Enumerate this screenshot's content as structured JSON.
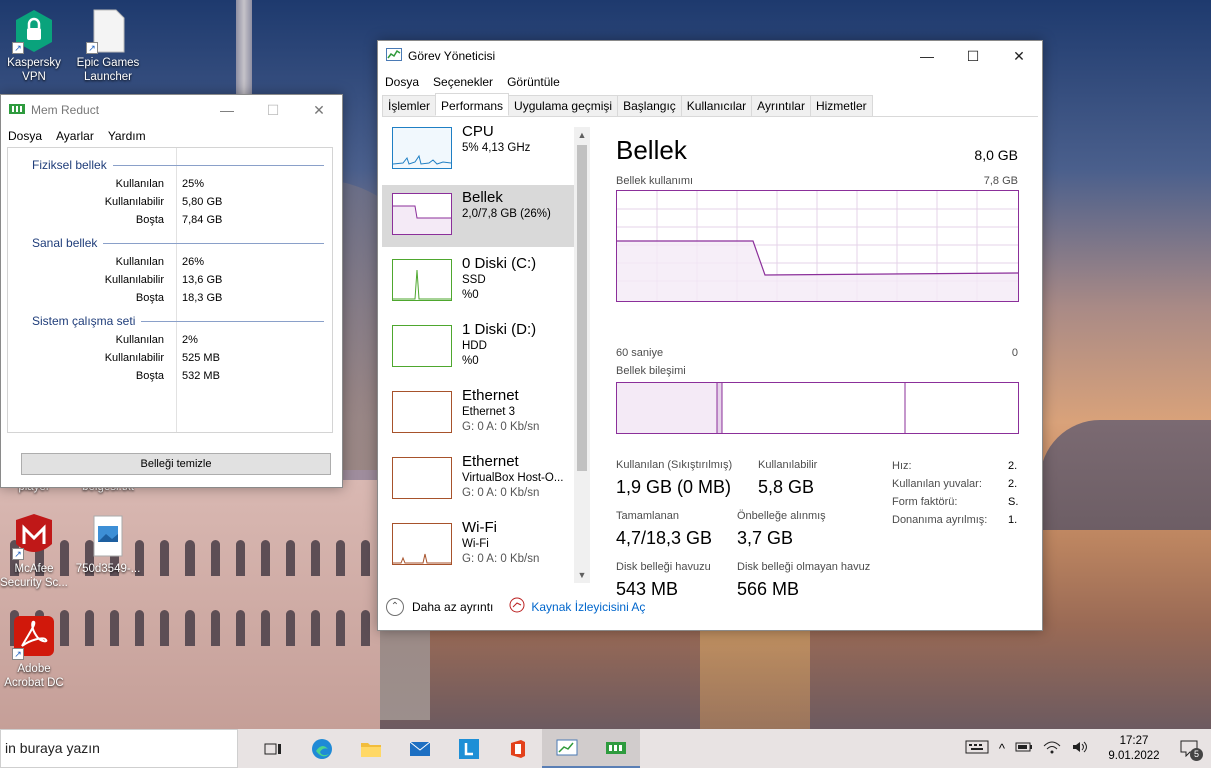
{
  "desktop": {
    "icons": [
      {
        "label": "Kaspersky VPN",
        "icon": "kaspersky-vpn-icon"
      },
      {
        "label": "Epic Games Launcher",
        "icon": "epic-games-icon"
      },
      {
        "label": "player",
        "icon": "player-icon"
      },
      {
        "label": "belgesi.txt",
        "icon": "text-file-icon"
      },
      {
        "label": "McAfee Security Sc...",
        "icon": "mcafee-icon"
      },
      {
        "label": "750d3549-...",
        "icon": "image-file-icon"
      },
      {
        "label": "Adobe Acrobat DC",
        "icon": "adobe-acrobat-icon"
      }
    ]
  },
  "memreduct": {
    "title": "Mem Reduct",
    "menu": [
      "Dosya",
      "Ayarlar",
      "Yardım"
    ],
    "sections": [
      {
        "header": "Fiziksel bellek",
        "rows": [
          {
            "k": "Kullanılan",
            "v": "25%"
          },
          {
            "k": "Kullanılabilir",
            "v": "5,80 GB"
          },
          {
            "k": "Boşta",
            "v": "7,84 GB"
          }
        ]
      },
      {
        "header": "Sanal bellek",
        "rows": [
          {
            "k": "Kullanılan",
            "v": "26%"
          },
          {
            "k": "Kullanılabilir",
            "v": "13,6 GB"
          },
          {
            "k": "Boşta",
            "v": "18,3 GB"
          }
        ]
      },
      {
        "header": "Sistem çalışma seti",
        "rows": [
          {
            "k": "Kullanılan",
            "v": "2%"
          },
          {
            "k": "Kullanılabilir",
            "v": "525 MB"
          },
          {
            "k": "Boşta",
            "v": "532 MB"
          }
        ]
      }
    ],
    "clean_button": "Belleği temizle"
  },
  "taskmgr": {
    "title": "Görev Yöneticisi",
    "menu": [
      "Dosya",
      "Seçenekler",
      "Görüntüle"
    ],
    "tabs": [
      "İşlemler",
      "Performans",
      "Uygulama geçmişi",
      "Başlangıç",
      "Kullanıcılar",
      "Ayrıntılar",
      "Hizmetler"
    ],
    "active_tab": "Performans",
    "sidebar": [
      {
        "name": "CPU",
        "l1": "5% 4,13 GHz",
        "l2": "",
        "color": "#1f7fc4"
      },
      {
        "name": "Bellek",
        "l1": "2,0/7,8 GB (26%)",
        "l2": "",
        "color": "#8b2f9a"
      },
      {
        "name": "0 Diski (C:)",
        "l1": "SSD",
        "l2": "%0",
        "color": "#4ea72e"
      },
      {
        "name": "1 Diski (D:)",
        "l1": "HDD",
        "l2": "%0",
        "color": "#4ea72e"
      },
      {
        "name": "Ethernet",
        "l1": "Ethernet 3",
        "l2": "G: 0 A: 0 Kb/sn",
        "color": "#a7522b"
      },
      {
        "name": "Ethernet",
        "l1": "VirtualBox Host-O...",
        "l2": "G: 0 A: 0 Kb/sn",
        "color": "#a7522b"
      },
      {
        "name": "Wi-Fi",
        "l1": "Wi-Fi",
        "l2": "G: 0 A: 0 Kb/sn",
        "color": "#a7522b"
      }
    ],
    "memory": {
      "title": "Bellek",
      "total": "8,0 GB",
      "usage_label": "Bellek kullanımı",
      "usage_max": "7,8 GB",
      "time_left": "60 saniye",
      "time_right": "0",
      "composition_label": "Bellek bileşimi",
      "stats": [
        {
          "k": "Kullanılan (Sıkıştırılmış)",
          "v": "1,9 GB (0 MB)"
        },
        {
          "k": "Kullanılabilir",
          "v": "5,8 GB"
        },
        {
          "k": "Tamamlanan",
          "v": "4,7/18,3 GB"
        },
        {
          "k": "Önbelleğe alınmış",
          "v": "3,7 GB"
        },
        {
          "k": "Disk belleği havuzu",
          "v": "543 MB"
        },
        {
          "k": "Disk belleği olmayan havuz",
          "v": "566 MB"
        }
      ],
      "details": [
        {
          "k": "Hız:",
          "v": "2."
        },
        {
          "k": "Kullanılan yuvalar:",
          "v": "2."
        },
        {
          "k": "Form faktörü:",
          "v": "S."
        },
        {
          "k": "Donanıma ayrılmış:",
          "v": "1."
        }
      ]
    },
    "footer": {
      "less": "Daha az ayrıntı",
      "resmon": "Kaynak İzleyicisini Aç"
    }
  },
  "taskbar": {
    "search_text": "in buraya yazın",
    "time": "17:27",
    "date": "9.01.2022",
    "notifications": "5"
  }
}
